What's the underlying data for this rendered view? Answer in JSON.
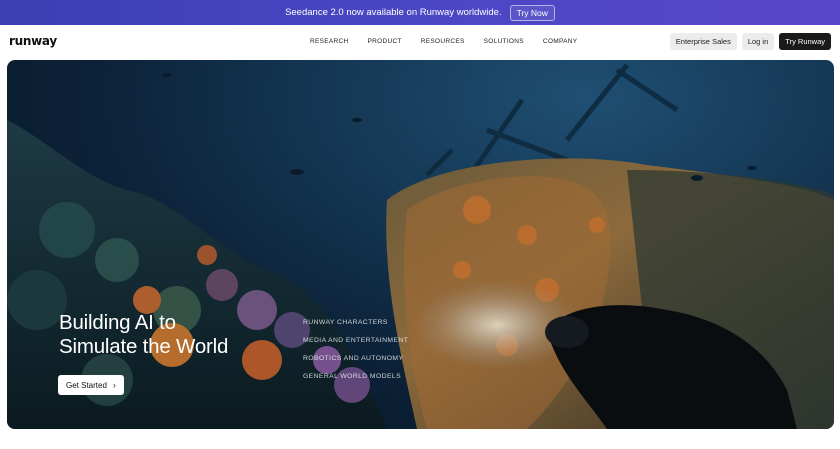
{
  "banner": {
    "text": "Seedance 2.0 now available on Runway worldwide.",
    "button": "Try Now"
  },
  "nav": {
    "logo": "runway",
    "links": [
      "RESEARCH",
      "PRODUCT",
      "RESOURCES",
      "SOLUTIONS",
      "COMPANY"
    ],
    "enterprise": "Enterprise Sales",
    "login": "Log in",
    "try": "Try Runway"
  },
  "hero": {
    "headline_1": "Building AI to",
    "headline_2": "Simulate the World",
    "cta": "Get Started",
    "categories": [
      "RUNWAY CHARACTERS",
      "MEDIA AND ENTERTAINMENT",
      "ROBOTICS AND AUTONOMY",
      "GENERAL WORLD MODELS"
    ]
  }
}
